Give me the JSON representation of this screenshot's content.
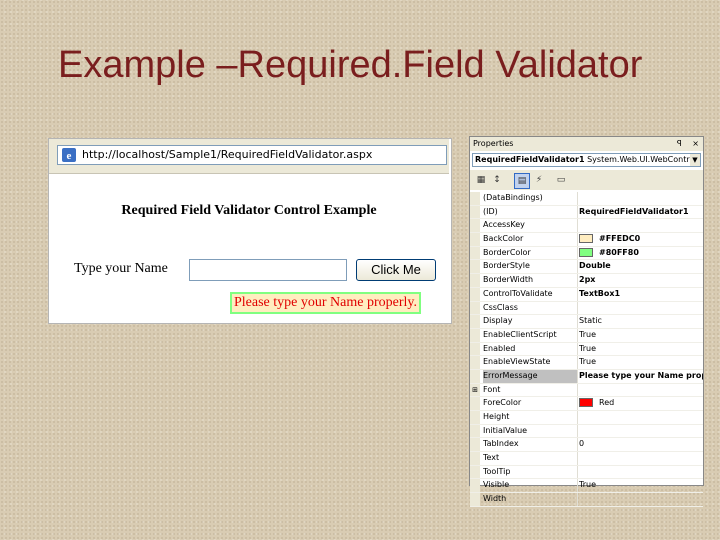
{
  "slide": {
    "title": "Example –Required.Field Validator"
  },
  "browser": {
    "address": "http://localhost/Sample1/RequiredFieldValidator.aspx",
    "heading": "Required Field Validator Control Example",
    "name_label": "Type your Name",
    "name_value": "",
    "button_label": "Click Me",
    "error_message": "Please type your Name properly."
  },
  "properties": {
    "title": "Properties",
    "pin": "ꟼ",
    "close": "×",
    "object_name": "RequiredFieldValidator1",
    "object_type": "System.Web.UI.WebControls",
    "rows": [
      {
        "name": "(DataBindings)",
        "value": ""
      },
      {
        "name": "(ID)",
        "value": "RequiredFieldValidator1",
        "bold": true
      },
      {
        "name": "AccessKey",
        "value": ""
      },
      {
        "name": "BackColor",
        "value": "#FFEDC0",
        "swatch": "#FFEDC0",
        "bold": true
      },
      {
        "name": "BorderColor",
        "value": "#80FF80",
        "swatch": "#80FF80",
        "bold": true
      },
      {
        "name": "BorderStyle",
        "value": "Double",
        "bold": true
      },
      {
        "name": "BorderWidth",
        "value": "2px",
        "bold": true
      },
      {
        "name": "ControlToValidate",
        "value": "TextBox1",
        "bold": true
      },
      {
        "name": "CssClass",
        "value": ""
      },
      {
        "name": "Display",
        "value": "Static"
      },
      {
        "name": "EnableClientScript",
        "value": "True"
      },
      {
        "name": "Enabled",
        "value": "True"
      },
      {
        "name": "EnableViewState",
        "value": "True"
      },
      {
        "name": "ErrorMessage",
        "value": "Please type your Name prope",
        "bold": true,
        "selected": true
      },
      {
        "name": "Font",
        "value": "",
        "expander": "⊞"
      },
      {
        "name": "ForeColor",
        "value": "Red",
        "swatch": "#FF0000"
      },
      {
        "name": "Height",
        "value": ""
      },
      {
        "name": "InitialValue",
        "value": ""
      },
      {
        "name": "TabIndex",
        "value": "0"
      },
      {
        "name": "Text",
        "value": ""
      },
      {
        "name": "ToolTip",
        "value": ""
      },
      {
        "name": "Visible",
        "value": "True"
      },
      {
        "name": "Width",
        "value": ""
      }
    ]
  },
  "colors": {
    "title": "#7a1e1e",
    "error_text": "#e00000"
  }
}
